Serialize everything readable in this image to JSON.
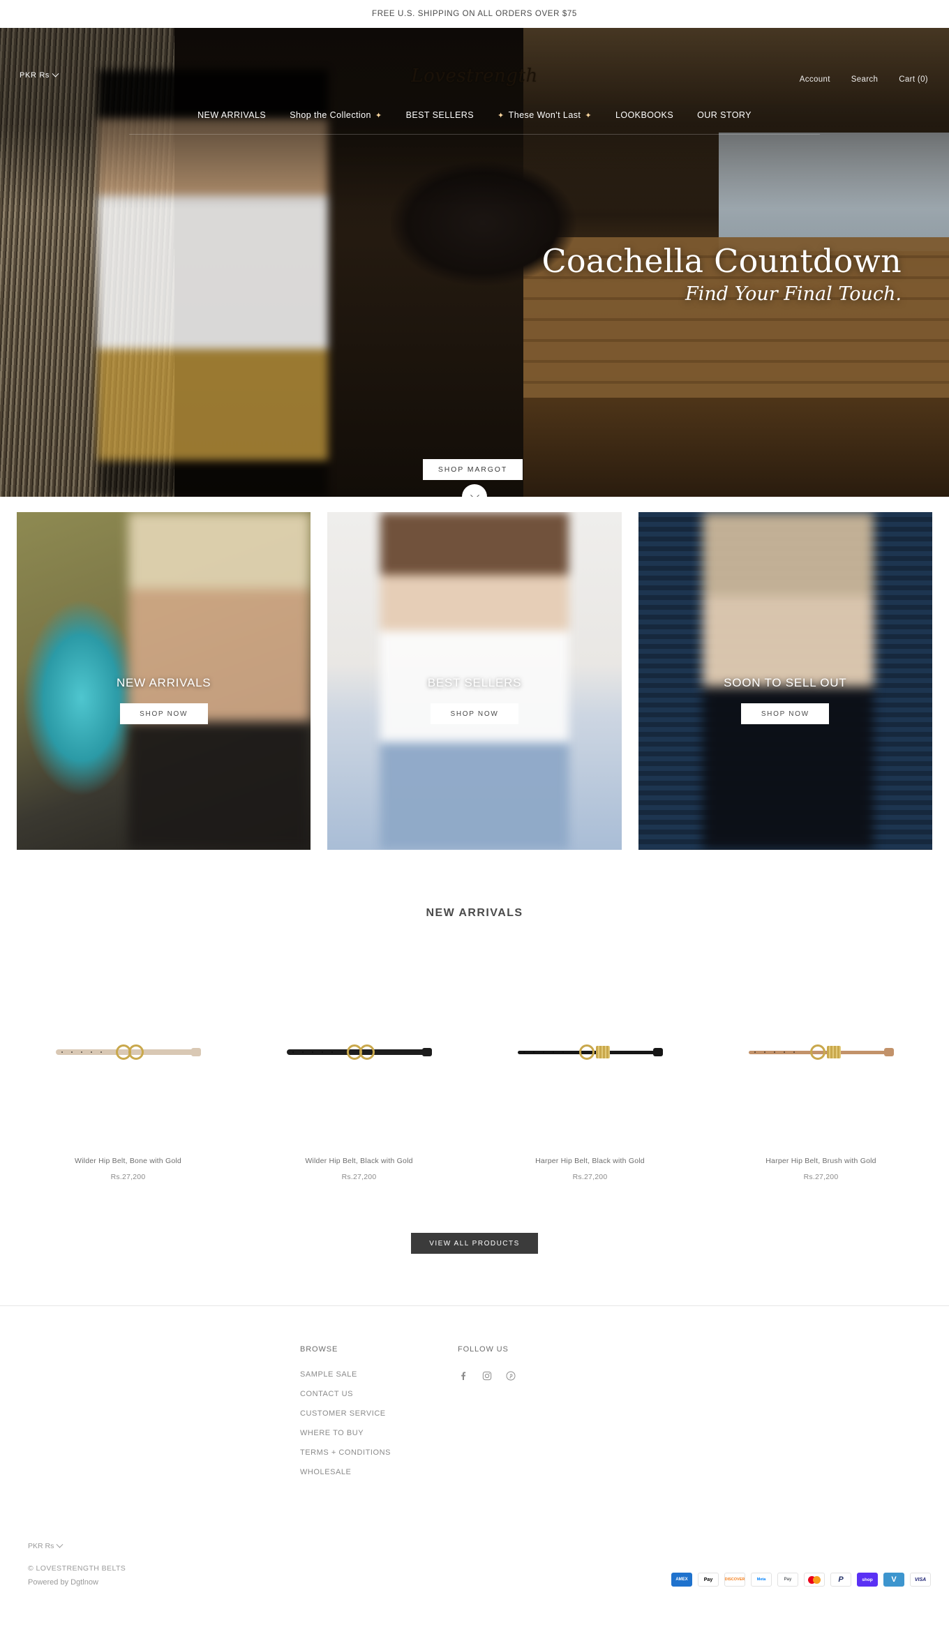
{
  "announcement": {
    "text": "FREE U.S. SHIPPING ON ALL ORDERS OVER $75"
  },
  "header": {
    "brand": "Lovestrength",
    "currency": "PKR Rs",
    "account_label": "Account",
    "search_label": "Search",
    "cart_label": "Cart (0)",
    "nav": [
      {
        "label": "NEW ARRIVALS",
        "sparkle_before": false,
        "sparkle_after": false
      },
      {
        "label": "Shop the Collection",
        "sparkle_before": false,
        "sparkle_after": true
      },
      {
        "label": "BEST SELLERS",
        "sparkle_before": false,
        "sparkle_after": false
      },
      {
        "label": "These Won't Last",
        "sparkle_before": true,
        "sparkle_after": true
      },
      {
        "label": "LOOKBOOKS",
        "sparkle_before": false,
        "sparkle_after": false
      },
      {
        "label": "OUR STORY",
        "sparkle_before": false,
        "sparkle_after": false
      }
    ]
  },
  "hero": {
    "title": "Coachella Countdown",
    "subtitle": "Find Your Final Touch.",
    "cta": "SHOP MARGOT"
  },
  "tiles": [
    {
      "label": "NEW ARRIVALS",
      "cta": "SHOP NOW"
    },
    {
      "label": "BEST SELLERS",
      "cta": "SHOP NOW"
    },
    {
      "label": "SOON TO SELL OUT",
      "cta": "SHOP NOW"
    }
  ],
  "new_arrivals": {
    "title": "NEW ARRIVALS",
    "view_all": "VIEW ALL PRODUCTS",
    "products": [
      {
        "name": "Wilder Hip Belt, Bone with Gold",
        "price": "Rs.27,200",
        "strap_color": "#d9c8b4",
        "style": "double-ring"
      },
      {
        "name": "Wilder Hip Belt, Black with Gold",
        "price": "Rs.27,200",
        "strap_color": "#1d1d1d",
        "style": "double-ring"
      },
      {
        "name": "Harper Hip Belt, Black with Gold",
        "price": "Rs.27,200",
        "strap_color": "#161616",
        "style": "wrap-band"
      },
      {
        "name": "Harper Hip Belt, Brush with Gold",
        "price": "Rs.27,200",
        "strap_color": "#c2926a",
        "style": "wrap-band"
      }
    ]
  },
  "footer": {
    "browse_title": "BROWSE",
    "browse_links": [
      "SAMPLE SALE",
      "CONTACT US",
      "CUSTOMER SERVICE",
      "WHERE TO BUY",
      "TERMS + CONDITIONS",
      "WHOLESALE"
    ],
    "follow_title": "FOLLOW US",
    "socials": [
      "facebook-icon",
      "instagram-icon",
      "pinterest-icon"
    ],
    "currency": "PKR Rs",
    "copyright": "© LOVESTRENGTH BELTS",
    "powered": "Powered by Dgtlnow",
    "payments": [
      {
        "name": "American Express",
        "short": "AMEX"
      },
      {
        "name": "Apple Pay",
        "short": "Pay"
      },
      {
        "name": "Discover",
        "short": "DISCOVER"
      },
      {
        "name": "Meta Pay",
        "short": "Meta"
      },
      {
        "name": "Google Pay",
        "short": "Pay"
      },
      {
        "name": "Mastercard",
        "short": ""
      },
      {
        "name": "PayPal",
        "short": "P"
      },
      {
        "name": "Shop Pay",
        "short": "shop"
      },
      {
        "name": "Venmo",
        "short": "V"
      },
      {
        "name": "Visa",
        "short": "VISA"
      }
    ]
  }
}
